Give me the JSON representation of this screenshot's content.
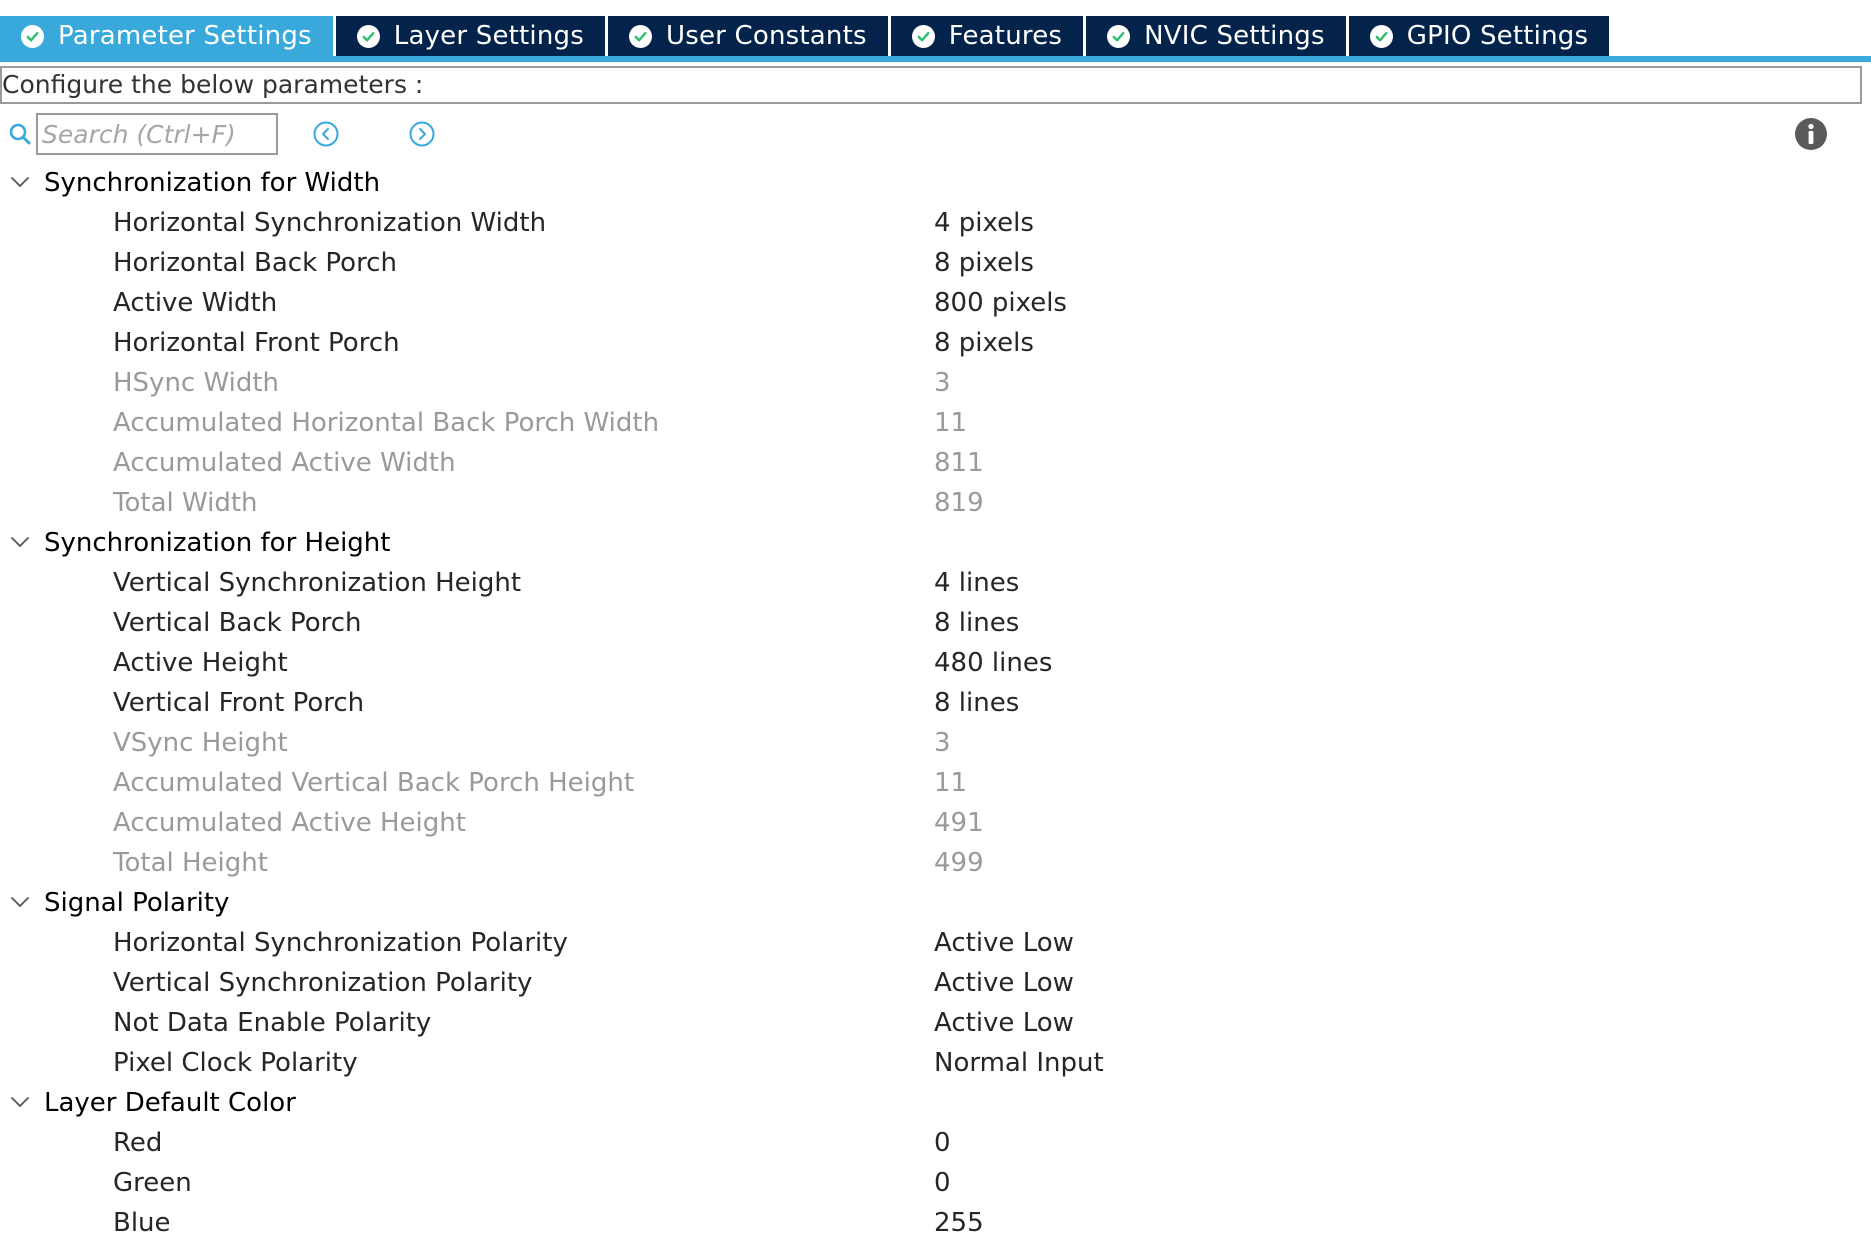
{
  "colors": {
    "tab_active": "#39a9dc",
    "tab_inactive": "#03234b",
    "tab_text": "#ffffff",
    "check_green": "#2dbf6e",
    "accent_blue": "#39a9dc",
    "disabled_text": "#9a9a9a",
    "enabled_text": "#262626"
  },
  "tabs": [
    {
      "label": "Parameter Settings",
      "active": true,
      "icon": "check-circle-icon"
    },
    {
      "label": "Layer Settings",
      "active": false,
      "icon": "check-circle-icon"
    },
    {
      "label": "User Constants",
      "active": false,
      "icon": "check-circle-icon"
    },
    {
      "label": "Features",
      "active": false,
      "icon": "check-circle-icon"
    },
    {
      "label": "NVIC Settings",
      "active": false,
      "icon": "check-circle-icon"
    },
    {
      "label": "GPIO Settings",
      "active": false,
      "icon": "check-circle-icon"
    }
  ],
  "description": "Configure the below parameters :",
  "search": {
    "placeholder": "Search (Ctrl+F)",
    "value": "",
    "prev_icon": "chevron-left-circle-icon",
    "next_icon": "chevron-right-circle-icon",
    "info_icon": "info-icon"
  },
  "groups": [
    {
      "title": "Synchronization for Width",
      "expanded": true,
      "params": [
        {
          "name": "Horizontal Synchronization Width",
          "value": "4 pixels",
          "enabled": true
        },
        {
          "name": "Horizontal Back Porch",
          "value": "8 pixels",
          "enabled": true
        },
        {
          "name": "Active Width",
          "value": "800 pixels",
          "enabled": true
        },
        {
          "name": "Horizontal Front Porch",
          "value": "8 pixels",
          "enabled": true
        },
        {
          "name": "HSync Width",
          "value": "3",
          "enabled": false
        },
        {
          "name": "Accumulated Horizontal Back Porch Width",
          "value": "11",
          "enabled": false
        },
        {
          "name": "Accumulated Active Width",
          "value": "811",
          "enabled": false
        },
        {
          "name": "Total Width",
          "value": "819",
          "enabled": false
        }
      ]
    },
    {
      "title": "Synchronization for Height",
      "expanded": true,
      "params": [
        {
          "name": "Vertical Synchronization Height",
          "value": "4 lines",
          "enabled": true
        },
        {
          "name": "Vertical Back Porch",
          "value": "8 lines",
          "enabled": true
        },
        {
          "name": "Active Height",
          "value": "480 lines",
          "enabled": true
        },
        {
          "name": "Vertical Front Porch",
          "value": "8 lines",
          "enabled": true
        },
        {
          "name": "VSync Height",
          "value": "3",
          "enabled": false
        },
        {
          "name": "Accumulated Vertical Back Porch Height",
          "value": "11",
          "enabled": false
        },
        {
          "name": "Accumulated Active Height",
          "value": "491",
          "enabled": false
        },
        {
          "name": "Total Height",
          "value": "499",
          "enabled": false
        }
      ]
    },
    {
      "title": "Signal Polarity",
      "expanded": true,
      "params": [
        {
          "name": "Horizontal Synchronization Polarity",
          "value": "Active Low",
          "enabled": true
        },
        {
          "name": "Vertical Synchronization Polarity",
          "value": "Active Low",
          "enabled": true
        },
        {
          "name": "Not Data Enable Polarity",
          "value": "Active Low",
          "enabled": true
        },
        {
          "name": "Pixel Clock Polarity",
          "value": "Normal Input",
          "enabled": true
        }
      ]
    },
    {
      "title": "Layer Default Color",
      "expanded": true,
      "params": [
        {
          "name": "Red",
          "value": "0",
          "enabled": true
        },
        {
          "name": "Green",
          "value": "0",
          "enabled": true
        },
        {
          "name": "Blue",
          "value": "255",
          "enabled": true
        }
      ]
    }
  ]
}
